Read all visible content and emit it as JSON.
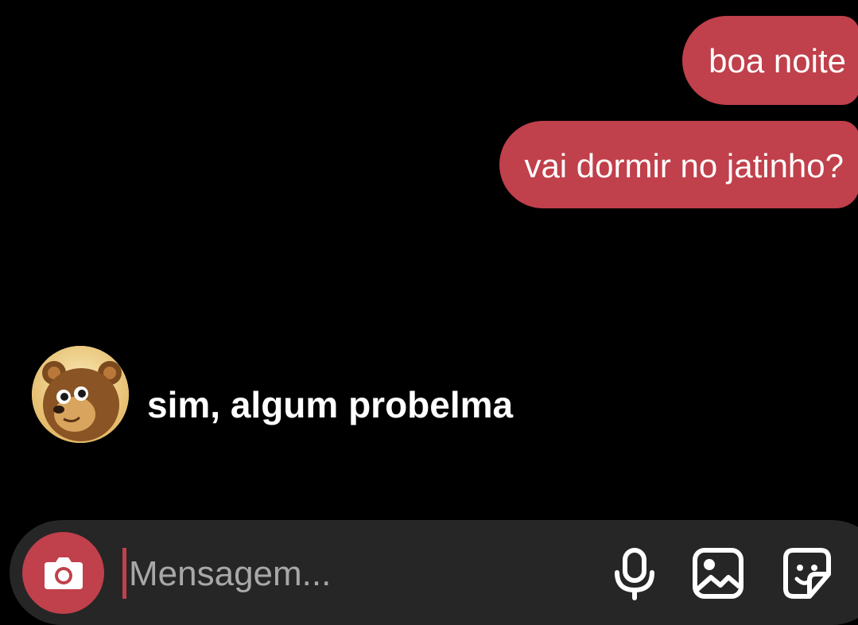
{
  "conversation": {
    "outgoing": [
      {
        "text": "boa noite"
      },
      {
        "text": "vai dormir no jatinho?"
      }
    ],
    "incoming": [
      {
        "text": "sim, algum probelma",
        "avatar_icon": "bear-avatar-icon"
      }
    ]
  },
  "composer": {
    "placeholder": "Mensagem...",
    "value": "",
    "camera_icon": "camera-icon",
    "mic_icon": "microphone-icon",
    "gallery_icon": "gallery-icon",
    "sticker_icon": "sticker-icon"
  },
  "colors": {
    "background": "#000000",
    "bubble": "#c0404b",
    "composer": "#262626",
    "placeholder": "#a8a8a8"
  }
}
